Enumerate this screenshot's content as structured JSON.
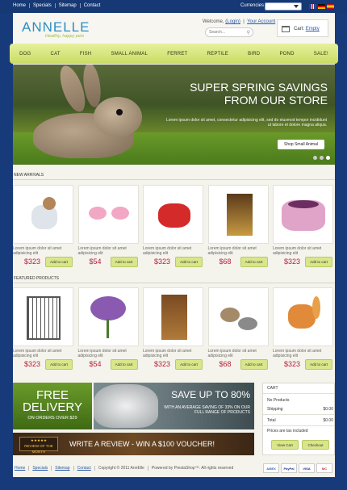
{
  "topbar": {
    "links": [
      "Home",
      "Specials",
      "Sitemap",
      "Contact"
    ],
    "currencies_label": "Currencies"
  },
  "header": {
    "logo": "ANNELLE",
    "tagline": "Healthy, happy pets",
    "welcome": "Welcome,",
    "login": "(Login)",
    "your_account": "Your Account",
    "search_placeholder": "Search...",
    "cart_label": "Cart:",
    "cart_status": "Empty"
  },
  "nav": [
    "DOG",
    "CAT",
    "FISH",
    "SMALL ANIMAL",
    "FERRET",
    "REPTILE",
    "BIRD",
    "POND",
    "SALE!"
  ],
  "hero": {
    "headline": "Super Spring Savings from our store",
    "subtext": "Lorem ipsum dolor sit amet, consectetur adipisicing elit, sed do eiusmod tempor incididunt ut labore et dolore magna aliqua.",
    "cta": "Shop Small Animal"
  },
  "new_arrivals": {
    "title": "NEW ARRIVALS",
    "items": [
      {
        "desc": "Lorem ipsum dolor sit amet adipisicing elit",
        "price": "$323",
        "button": "Add to cart"
      },
      {
        "desc": "Lorem ipsum dolor sit amet adipisicing elit",
        "price": "$54",
        "button": "Add to cart"
      },
      {
        "desc": "Lorem ipsum dolor sit amet adipisicing elit",
        "price": "$323",
        "button": "Add to cart"
      },
      {
        "desc": "Lorem ipsum dolor sit amet adipisicing elit",
        "price": "$68",
        "button": "Add to cart"
      },
      {
        "desc": "Lorem ipsum dolor sit amet adipisicing elit",
        "price": "$323",
        "button": "Add to cart"
      }
    ]
  },
  "featured": {
    "title": "FEATURED PRODUCTS",
    "items": [
      {
        "desc": "Lorem ipsum dolor sit amet adipisicing elit",
        "price": "$323",
        "button": "Add to cart"
      },
      {
        "desc": "Lorem ipsum dolor sit amet adipisicing elit",
        "price": "$54",
        "button": "Add to cart"
      },
      {
        "desc": "Lorem ipsum dolor sit amet adipisicing elit",
        "price": "$323",
        "button": "Add to cart"
      },
      {
        "desc": "Lorem ipsum dolor sit amet adipisicing elit",
        "price": "$68",
        "button": "Add to cart"
      },
      {
        "desc": "Lorem ipsum dolor sit amet adipisicing elit",
        "price": "$323",
        "button": "Add to cart"
      }
    ]
  },
  "promos": {
    "free_big": "FREE DELIVERY",
    "free_small": "ON ORDERS OVER $29",
    "save_big": "SAVE UP TO 80%",
    "save_small": "WITH AN AVERAGE SAVING OF 33% ON OUR FULL RANGE OF PRODUCTS",
    "review_badge": "REVIEW OF THE MONTH",
    "review_text": "WRITE A REVIEW - WIN A $100 VOUCHER!"
  },
  "cart_widget": {
    "title": "CART",
    "no_products": "No Products",
    "shipping_label": "Shipping",
    "shipping_value": "$0.00",
    "total_label": "Total",
    "total_value": "$0.00",
    "note": "Prices are tax included",
    "view_cart": "View Cart",
    "checkout": "Checkout"
  },
  "footer": {
    "links": [
      "Home",
      "Specials",
      "Sitemap",
      "Contact"
    ],
    "copyright": "Copyright © 2011 AnnElle",
    "powered": "Powered by PrestaShop™. All rights reserved",
    "cards": [
      "AMEX",
      "PayPal",
      "VISA",
      "MC"
    ]
  },
  "colors": {
    "background": "#173a7a",
    "accent_green": "#d9e68a",
    "price_red": "#b8203a",
    "logo_blue": "#2d8ec3"
  }
}
